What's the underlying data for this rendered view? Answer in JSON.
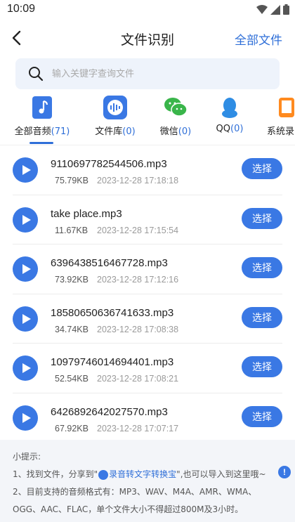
{
  "status_bar": {
    "time": "10:09"
  },
  "header": {
    "title": "文件识别",
    "right_action": "全部文件"
  },
  "search": {
    "placeholder": "输入关键字查询文件"
  },
  "tabs": [
    {
      "label": "全部音频",
      "count": "(71)",
      "icon": "music-note-icon",
      "color": "#3a78e4",
      "active": true
    },
    {
      "label": "文件库",
      "count": "(0)",
      "icon": "waveform-icon",
      "color": "#3a78e4"
    },
    {
      "label": "微信",
      "count": "(0)",
      "icon": "wechat-icon",
      "color": "#39b54a"
    },
    {
      "label": "QQ",
      "count": "(0)",
      "icon": "qq-penguin-icon",
      "color": "#2f8de4"
    },
    {
      "label": "系统录",
      "count": "",
      "icon": "phone-recorder-icon",
      "color": "#ff8a1f"
    }
  ],
  "files": [
    {
      "name": "9110697782544506.mp3",
      "size": "75.79KB",
      "date": "2023-12-28 17:18:18",
      "action": "选择"
    },
    {
      "name": "take place.mp3",
      "size": "11.67KB",
      "date": "2023-12-28 17:15:54",
      "action": "选择"
    },
    {
      "name": "6396438516467728.mp3",
      "size": "73.92KB",
      "date": "2023-12-28 17:12:16",
      "action": "选择"
    },
    {
      "name": "18580650636741633.mp3",
      "size": "34.74KB",
      "date": "2023-12-28 17:08:38",
      "action": "选择"
    },
    {
      "name": "10979746014694401.mp3",
      "size": "52.54KB",
      "date": "2023-12-28 17:08:21",
      "action": "选择"
    },
    {
      "name": "6426892642027570.mp3",
      "size": "67.92KB",
      "date": "2023-12-28 17:07:17",
      "action": "选择"
    }
  ],
  "tips": {
    "title": "小提示:",
    "line1_prefix": "1、找到文件，分享到\"",
    "line1_brand": "录音转文字转换宝",
    "line1_suffix": "\",也可以导入到这里哦~",
    "line2": "2、目前支持的音频格式有：MP3、WAV、M4A、AMR、WMA、",
    "line3": "OGG、AAC、FLAC，单个文件大小不得超过800M及3小时。",
    "info_icon": "!"
  },
  "colors": {
    "accent": "#3a78e4",
    "link": "#2f6fd8"
  }
}
